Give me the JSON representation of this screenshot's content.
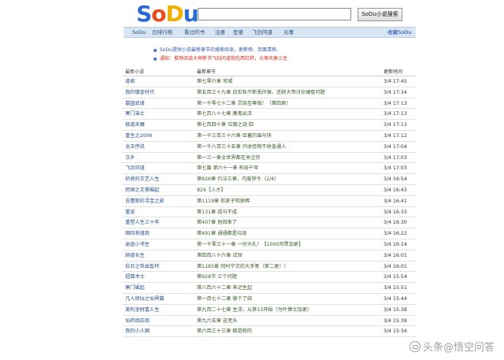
{
  "logo": {
    "parts": [
      "S",
      "o",
      "D",
      "u"
    ]
  },
  "search": {
    "value": "",
    "button_label": "SoDu小说搜索"
  },
  "nav": {
    "items": [
      "SoDu",
      "日排行榜",
      "看过的书",
      "注册",
      "登录",
      "飞剑问道",
      "元尊"
    ],
    "right_link": "收藏SoDu"
  },
  "notices": [
    "SoDu提供小说最新章节的搜索阅读，更新快、页面清爽。",
    "通知：推荐阅读大神新书飞剑问道我吃西红柿，元尊天蚕土豆"
  ],
  "table": {
    "headers": {
      "name": "最新小说",
      "chapter": "最新章节",
      "time": "更新时间"
    },
    "rows": [
      {
        "name": "道君",
        "chapter": "第七零六章 攻城",
        "time": "3/4 17:45"
      },
      {
        "name": "我的镀金时代",
        "chapter": "第五百三十九章 白实秋不断丢炸弹，还顾大哥讨论硬度问题",
        "time": "3/4 17:34"
      },
      {
        "name": "墓园武道",
        "chapter": "第一千零七十二章 灵焰至尊版！（第四更）",
        "time": "3/4 17:13"
      },
      {
        "name": "寒门枭士",
        "chapter": "第七百八十七章 魔鬼出活",
        "time": "3/4 17:13"
      },
      {
        "name": "极道天魔",
        "chapter": "第七百四十章 位面之战 四",
        "time": "3/4 17:13"
      },
      {
        "name": "重生之2006",
        "chapter": "第一千三百三十六章 巨蓄的眉与快",
        "time": "3/4 17:12"
      },
      {
        "name": "龙王传说",
        "chapter": "第一千八百三十五章 只收怪物不收普通人",
        "time": "3/4 17:04"
      },
      {
        "name": "汉乡",
        "chapter": "第一三一章全世界都在关注你",
        "time": "3/4 17:03"
      },
      {
        "name": "飞剑问道",
        "chapter": "第七篇 第六十一章 布局千年",
        "time": "3/4 17:03"
      },
      {
        "name": "奶爸的文艺人生",
        "chapter": "第926章 约法三章，巧废除令（2/4）",
        "time": "3/4 16:54"
      },
      {
        "name": "民国之文豪崛起",
        "chapter": "829【人才】",
        "time": "3/4 16:43"
      },
      {
        "name": "吉蕾斯的寻宝之旅",
        "chapter": "第1119章 败家子和狼稀",
        "time": "3/4 16:41"
      },
      {
        "name": "重宠",
        "chapter": "第131章 成与不成",
        "time": "3/4 16:33"
      },
      {
        "name": "重塑人生三十年",
        "chapter": "第407章 他回来了",
        "time": "3/4 16:30"
      },
      {
        "name": "国际刺道商",
        "chapter": "第491章 通通都是垃圾",
        "time": "3/4 16:22"
      },
      {
        "name": "逍遥小书生",
        "chapter": "第一千零三十一章 一份大礼！【1000月票加更】",
        "time": "3/4 16:14"
      },
      {
        "name": "顾道长生",
        "chapter": "第四百八十六章 试探",
        "time": "3/4 16:01"
      },
      {
        "name": "抗日之铁血智将",
        "chapter": "第1185章 冈村宁次的大手笔（第二更！）",
        "time": "3/4 16:01"
      },
      {
        "name": "超僧术士",
        "chapter": "第928节 三个问题",
        "time": "3/4 15:54"
      },
      {
        "name": "寒门崛起",
        "chapter": "第八百六十二章 朱记生起",
        "time": "3/4 15:51"
      },
      {
        "name": "凡人修仙之仙界篇",
        "chapter": "第一百七十二章 做个了结",
        "time": "3/4 15:44"
      },
      {
        "name": "美利坚财富人生",
        "chapter": "第九百二十七章 生活，从第13开始（为叶博士加更）",
        "time": "3/4 15:38"
      },
      {
        "name": "仙药供应商",
        "chapter": "第九六五章 这老头",
        "time": "3/4 15:38"
      },
      {
        "name": "我的小人国",
        "chapter": "第六百三十三章 都是假的",
        "time": "3/4 15:34"
      }
    ]
  },
  "watermark": {
    "text": "头条@悟空问答"
  }
}
